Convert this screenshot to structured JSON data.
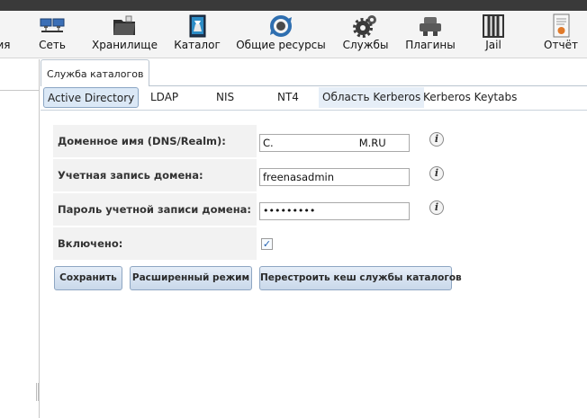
{
  "toolbar": {
    "items": [
      {
        "label": "ия",
        "icon": "system-icon"
      },
      {
        "label": "Сеть",
        "icon": "network-icon"
      },
      {
        "label": "Хранилище",
        "icon": "storage-folder-icon"
      },
      {
        "label": "Каталог",
        "icon": "directory-book-icon"
      },
      {
        "label": "Общие ресурсы",
        "icon": "sharing-icon"
      },
      {
        "label": "Службы",
        "icon": "services-gears-icon"
      },
      {
        "label": "Плагины",
        "icon": "plugins-icon"
      },
      {
        "label": "Jail",
        "icon": "jail-icon"
      },
      {
        "label": "Отчёт",
        "icon": "report-icon"
      }
    ]
  },
  "outer_tab": {
    "label": "Служба каталогов"
  },
  "inner_tabs": [
    {
      "label": "Active Directory",
      "state": "active"
    },
    {
      "label": "LDAP",
      "state": "normal"
    },
    {
      "label": "NIS",
      "state": "normal"
    },
    {
      "label": "NT4",
      "state": "normal"
    },
    {
      "label": "Область Kerberos",
      "state": "hover"
    },
    {
      "label": "Kerberos Keytabs",
      "state": "normal"
    }
  ],
  "form": {
    "domain_name": {
      "label": "Доменное имя (DNS/Realm):",
      "value_start": "C.",
      "value_end": "M.RU"
    },
    "domain_account": {
      "label": "Учетная запись домена:",
      "value": "freenasadmin"
    },
    "domain_password": {
      "label": "Пароль учетной записи домена:",
      "value": "•••••••••"
    },
    "enabled": {
      "label": "Включено:",
      "checked": true
    }
  },
  "buttons": {
    "save": "Сохранить",
    "advanced": "Расширенный режим",
    "rebuild_cache": "Перестроить кеш службы каталогов"
  },
  "colors": {
    "toolbar_bg": "#f4f4f4",
    "top_strip": "#3a3a3a",
    "active_tab_bg": "#dbe8f6",
    "button_bg": "#c9d8ea"
  }
}
